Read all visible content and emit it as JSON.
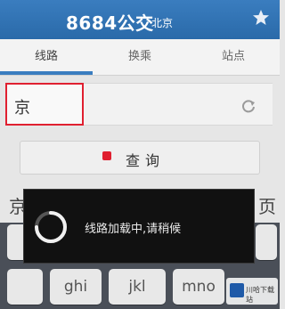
{
  "header": {
    "title": "8684公交",
    "city": "北京"
  },
  "tabs": [
    {
      "label": "线路",
      "active": true
    },
    {
      "label": "换乘",
      "active": false
    },
    {
      "label": "站点",
      "active": false
    }
  ],
  "search": {
    "value": "京"
  },
  "query_button": {
    "label": "查询"
  },
  "candidates": {
    "left": "京",
    "right": "页"
  },
  "keyboard": {
    "keys": [
      "ghi",
      "jkl",
      "mno"
    ]
  },
  "dialog": {
    "message": "线路加载中,请稍候"
  },
  "colors": {
    "accent": "#3a7dbf",
    "error": "#e02030",
    "dialog_bg": "#111111"
  },
  "icons": [
    "star-icon",
    "refresh-icon",
    "spinner-icon",
    "download-logo-icon"
  ]
}
